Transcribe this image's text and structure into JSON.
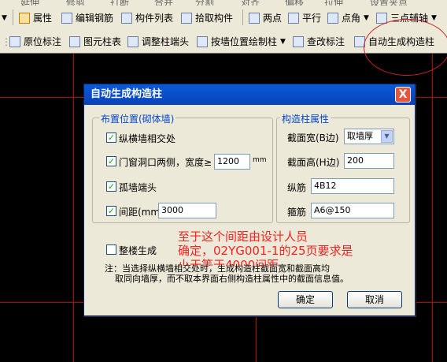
{
  "toolbar_top": {
    "items": [
      "延伸",
      "修剪",
      "打断",
      "合并",
      "分割",
      "对齐",
      "偏移",
      "拉伸",
      "设置夹点"
    ]
  },
  "toolbar1": {
    "items": [
      {
        "icon": "property-icon",
        "label": "属性"
      },
      {
        "icon": "edit-rebar-icon",
        "label": "编辑钢筋"
      },
      {
        "icon": "list-icon",
        "label": "构件列表"
      },
      {
        "icon": "pick-icon",
        "label": "拾取构件"
      },
      {
        "icon": "two-point-icon",
        "label": "两点"
      },
      {
        "icon": "parallel-icon",
        "label": "平行"
      },
      {
        "icon": "point-angle-icon",
        "label": "点角"
      },
      {
        "icon": "three-point-axis-icon",
        "label": "三点辅轴"
      }
    ]
  },
  "toolbar2": {
    "items": [
      {
        "icon": "origin-mark-icon",
        "label": "原位标注"
      },
      {
        "icon": "drawing-column-table-icon",
        "label": "图元柱表"
      },
      {
        "icon": "adjust-column-end-icon",
        "label": "调整柱端头"
      },
      {
        "icon": "wall-draw-column-icon",
        "label": "按墙位置绘制柱"
      },
      {
        "icon": "check-mark-icon",
        "label": "查改标注"
      },
      {
        "icon": "auto-column-icon",
        "label": "自动生成构造柱"
      }
    ]
  },
  "dialog": {
    "title": "自动生成构造柱",
    "close": "X",
    "placement": {
      "title": "布置位置(砌体墙)",
      "cross": "纵横墙相交处",
      "window": "门窗洞口两侧，宽度≥",
      "window_value": "1200",
      "window_unit": "mm",
      "isolated": "孤墙端头",
      "spacing": "间距(mm)",
      "spacing_value": "3000"
    },
    "attrs": {
      "title": "构造柱属性",
      "width_label": "截面宽(B边)",
      "width_value": "取墙厚",
      "height_label": "截面高(H边)",
      "height_value": "200",
      "long_label": "纵筋",
      "long_value": "4B12",
      "stirrup_label": "箍筋",
      "stirrup_value": "A6@150"
    },
    "whole_floor": "整楼生成",
    "note_line1": "注：当选择纵横墙相交处时，生成构造柱截面宽和截面高均",
    "note_line2": "取同向墙厚，而不取本界面右侧构造柱属性中的截面信息值。",
    "ok": "确定",
    "cancel": "取消"
  },
  "annotation": {
    "line1": "至于这个间距由设计人员",
    "line2": "确定，02YG001-1的25页要求是",
    "line3": "小于等于4000间距"
  },
  "colors": {
    "annotation": "#ff2020",
    "grid": "#c00000",
    "accent": "#0a5ad8"
  }
}
